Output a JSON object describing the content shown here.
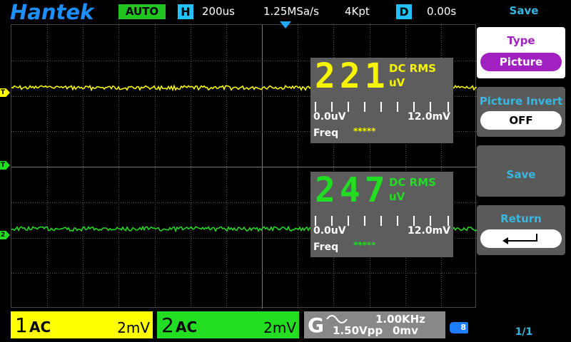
{
  "brand": "Hantek",
  "top": {
    "mode": "AUTO",
    "h_tag": "H",
    "timebase": "200us",
    "sample_rate": "1.25MSa/s",
    "memory_depth": "4Kpt",
    "d_tag": "D",
    "delay": "0.00s"
  },
  "markers": {
    "ch1": "T",
    "trig": "T",
    "ch2": "2"
  },
  "meters": [
    {
      "digits": "221",
      "type": "DC RMS",
      "unit": "uV",
      "scale_min": "0.0uV",
      "scale_max": "12.0mV",
      "freq_label": "Freq",
      "freq_value": "*****",
      "color": "#f5f500"
    },
    {
      "digits": "247",
      "type": "DC RMS",
      "unit": "uV",
      "scale_min": "0.0uV",
      "scale_max": "12.0mV",
      "freq_label": "Freq",
      "freq_value": "*****",
      "color": "#22dd22"
    }
  ],
  "channels": [
    {
      "num": "1",
      "coupling": "AC",
      "scale": "2mV",
      "color": "#ffff00"
    },
    {
      "num": "2",
      "coupling": "AC",
      "scale": "2mV",
      "color": "#22dd22"
    }
  ],
  "trigger": {
    "source": "G",
    "frequency": "1.00KHz",
    "amplitude": "1.50Vpp",
    "offset": "0mv"
  },
  "battery_label": "8",
  "menu": {
    "title": "Save",
    "type_label": "Type",
    "type_value": "Picture",
    "invert_label": "Picture Invert",
    "invert_value": "OFF",
    "save_label": "Save",
    "return_label": "Return",
    "page": "1/1"
  },
  "colors": {
    "ch1": "#ffff00",
    "ch2": "#22dd22",
    "accent": "#21c2ff",
    "menu_text": "#37b8e0",
    "type_pill": "#a020c0"
  }
}
